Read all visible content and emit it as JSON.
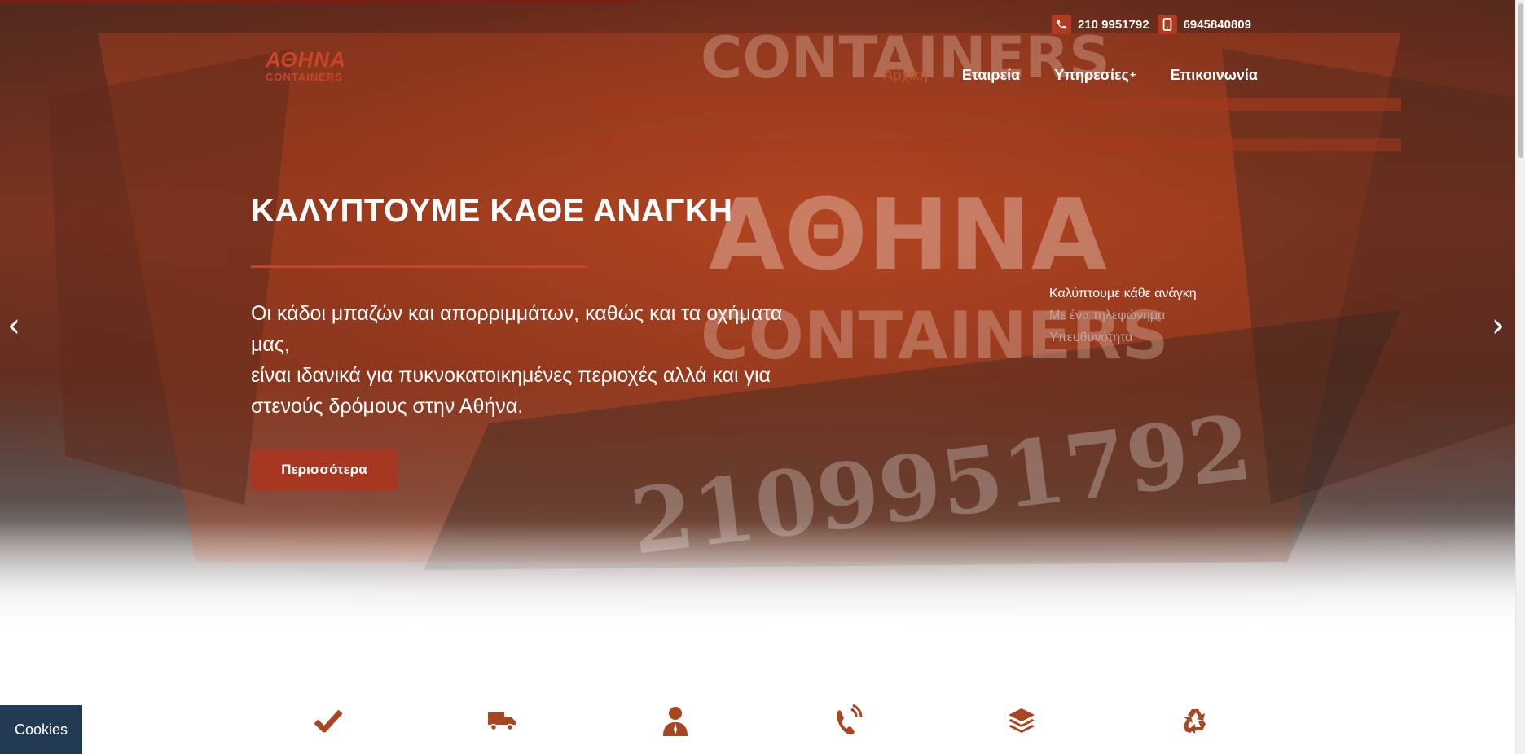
{
  "header": {
    "logo_line1": "ΑΘΗΝΑ",
    "logo_line2": "CONTAINERS",
    "phone_landline": "210 9951792",
    "phone_mobile": "6945840809",
    "nav": [
      {
        "label": "Αρχική",
        "active": true
      },
      {
        "label": "Εταιρεία",
        "active": false
      },
      {
        "label": "Υπηρεσίες",
        "suffix": "+",
        "active": false
      },
      {
        "label": "Επικοινωνία",
        "active": false
      }
    ]
  },
  "hero": {
    "title": "ΚΑΛΥΠΤΟΥΜΕ ΚΑΘΕ ΑΝΑΓΚΗ",
    "text_line1": "Οι κάδοι μπαζών και απορριμμάτων, καθώς και τα οχήματα μας,",
    "text_line2": "είναι ιδανικά για πυκνοκατοικημένες περιοχές αλλά και για στενούς δρόμους στην Αθήνα.",
    "button_label": "Περισσότερα",
    "slide_tabs": [
      {
        "label": "Καλύπτουμε κάθε ανάγκη",
        "active": true
      },
      {
        "label": "Με ένα τηλεφώνημα",
        "active": false
      },
      {
        "label": "Υπευθυνότητα",
        "active": false
      }
    ],
    "prev_arrow": "‹",
    "next_arrow": "›"
  },
  "features": {
    "icons": [
      "check-icon",
      "truck-icon",
      "person-icon",
      "phone-ringing-icon",
      "layers-icon",
      "recycle-icon"
    ],
    "color": "#a9451f"
  },
  "cookies": {
    "label": "Cookies"
  },
  "colors": {
    "accent": "#a73720",
    "nav_active": "#c4532f",
    "cookie_bg": "#233a55"
  }
}
